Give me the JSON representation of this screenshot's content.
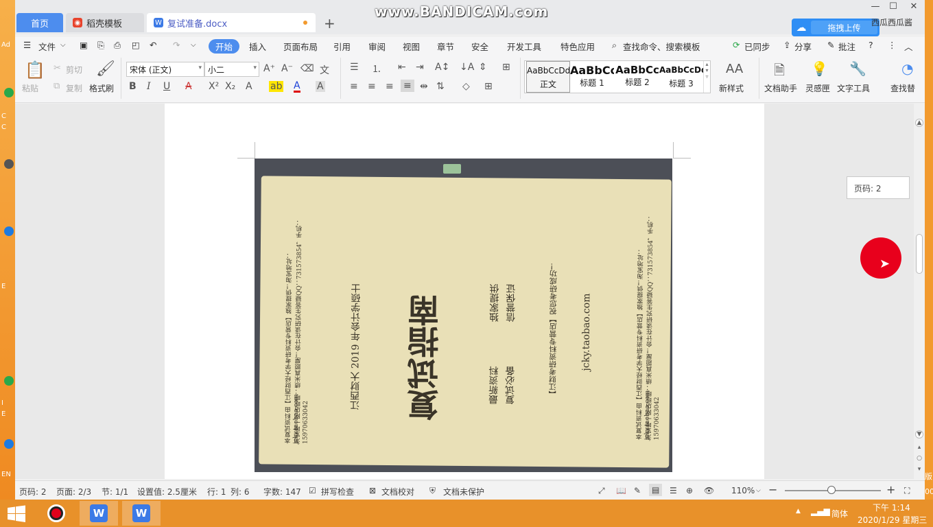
{
  "desktop": {
    "edge_labels": [
      "Ad",
      "C",
      "C",
      "E",
      "I",
      "E",
      "EN"
    ],
    "right_labels": [
      "版",
      "00"
    ]
  },
  "watermark": "www.BANDICAM.com",
  "window_controls": {
    "minimize": "—",
    "maximize": "☐",
    "close": "✕"
  },
  "tabs": [
    {
      "label": "首页",
      "type": "home"
    },
    {
      "label": "稻壳模板",
      "type": "template"
    },
    {
      "label": "复试准备.docx",
      "type": "document",
      "active": true
    }
  ],
  "new_tab": "+",
  "cloud": {
    "label": "拖拽上传"
  },
  "user": {
    "name": "西瓜西瓜酱"
  },
  "menu": {
    "file": "文件",
    "items": [
      "开始",
      "插入",
      "页面布局",
      "引用",
      "审阅",
      "视图",
      "章节",
      "安全",
      "开发工具",
      "特色应用"
    ],
    "search": "查找命令、搜索模板",
    "sync": "已同步",
    "share": "分享",
    "comment": "批注",
    "help": "?"
  },
  "ribbon": {
    "paste": "粘贴",
    "cut": "剪切",
    "copy": "复制",
    "format_painter": "格式刷",
    "font": "宋体 (正文)",
    "font_size": "小二",
    "styles": [
      {
        "sample": "AaBbCcDd",
        "name": "正文"
      },
      {
        "sample": "AaBbCc",
        "name": "标题 1"
      },
      {
        "sample": "AaBbCc",
        "name": "标题 2"
      },
      {
        "sample": "AaBbCcDd",
        "name": "标题 3"
      }
    ],
    "new_style": "新样式",
    "doc_helper": "文档助手",
    "inspiration": "灵感匣",
    "text_tools": "文字工具",
    "find_replace": "查找替"
  },
  "document": {
    "page_indicator": "页码: 2",
    "cover": {
      "side_left_1": "本复试资料由【江西财经大学考研资料专营店】独家提供！淘宝地址：jcky.taobao.com",
      "side_left_2": "淘宝唯一网店旺旺：绩米真题屋！会计在读研究生答疑QQ：731573854，手机：15970633042",
      "title_line": "江西财大 2019 年会计学硕士",
      "big_title": "复试指南",
      "col1": "最新资料",
      "col2": "复试必备",
      "col3": "独家提供",
      "col4": "信誉保证",
      "shop": "【江财考研资料专营店】祝您考研成功！",
      "url": "jcky.taobao.com",
      "side_right_1": "本复试资料由【江西财经大学考研资料专营店】独家提供！淘宝地址：jcky.taobao.com",
      "side_right_2": "淘宝唯一网店旺旺：绩米真题屋！会计在读研究生答疑QQ：731573854，手机：15970633042"
    }
  },
  "status": {
    "page_no": "页码: 2",
    "pages": "页面: 2/3",
    "section": "节: 1/1",
    "setting": "设置值: 2.5厘米",
    "row": "行: 1",
    "col": "列: 6",
    "words": "字数: 147",
    "spell": "拼写检查",
    "proof": "文档校对",
    "protect": "文档未保护",
    "zoom": "110%"
  },
  "taskbar": {
    "ime": "简体",
    "time": "下午 1:14",
    "date": "2020/1/29 星期三"
  },
  "colors": {
    "accent": "#4d8dee",
    "taskbar": "#e8912a",
    "record": "#e8001c"
  }
}
